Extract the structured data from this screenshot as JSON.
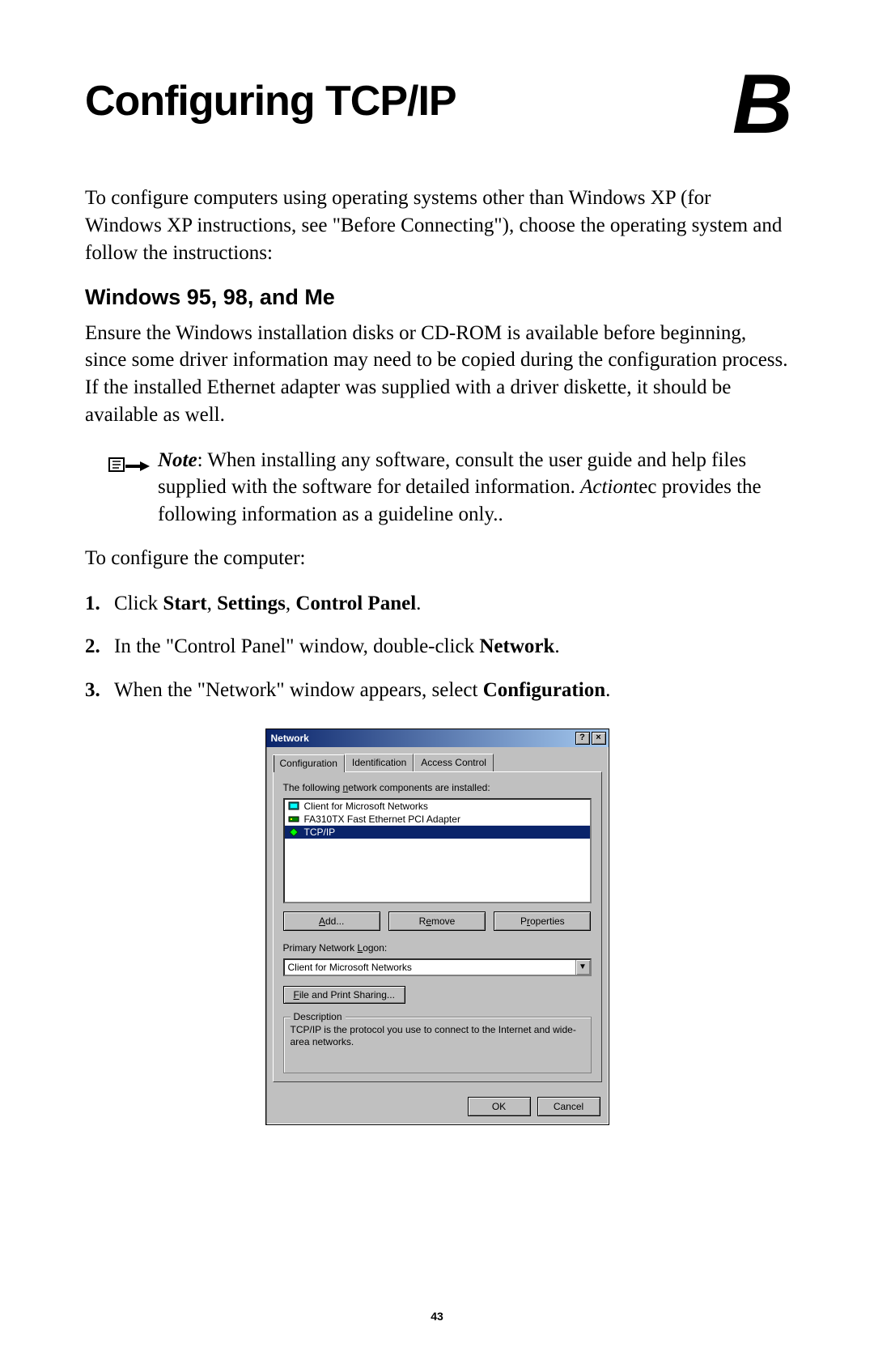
{
  "page": {
    "title": "Configuring TCP/IP",
    "chapter_letter": "B",
    "page_number": "43"
  },
  "intro": "To configure computers using operating systems other than Windows XP (for Windows XP instructions, see \"Before Connecting\"), choose the operating system and follow the instructions:",
  "subhead": "Windows 95, 98, and Me",
  "para2": "Ensure the Windows installation disks or CD-ROM is available before beginning, since some driver information may need to be copied during the configuration process. If the installed Ethernet adapter was supplied with a driver diskette, it should be available as well.",
  "note": {
    "label": "Note",
    "body1": ": When installing any software, consult the user guide and help files supplied with the software for detailed information. ",
    "action_brand": "Action",
    "body2": "tec provides the following information as a guideline only.."
  },
  "para3": "To configure the computer:",
  "steps": {
    "s1_pre": "Click ",
    "s1_b1": "Start",
    "s1_sep1": ", ",
    "s1_b2": "Settings",
    "s1_sep2": ", ",
    "s1_b3": "Control Panel",
    "s1_post": ".",
    "s2_pre": "In the \"Control Panel\" window, double-click ",
    "s2_b": "Network",
    "s2_post": ".",
    "s3_pre": "When the \"Network\" window appears, select ",
    "s3_b": "Configuration",
    "s3_post": "."
  },
  "dialog": {
    "title": "Network",
    "help_btn": "?",
    "close_btn": "×",
    "tabs": {
      "t1": "Configuration",
      "t2": "Identification",
      "t3": "Access Control"
    },
    "components_label": "The following network components are installed:",
    "components": {
      "c1": "Client for Microsoft Networks",
      "c2": "FA310TX Fast Ethernet PCI Adapter",
      "c3": "TCP/IP"
    },
    "buttons": {
      "add": "Add...",
      "remove": "Remove",
      "properties": "Properties"
    },
    "logon_label": "Primary Network Logon:",
    "logon_value": "Client for Microsoft Networks",
    "file_share_btn": "File and Print Sharing...",
    "desc_legend": "Description",
    "desc_text": "TCP/IP is the protocol you use to connect to the Internet and wide-area networks.",
    "ok": "OK",
    "cancel": "Cancel"
  }
}
